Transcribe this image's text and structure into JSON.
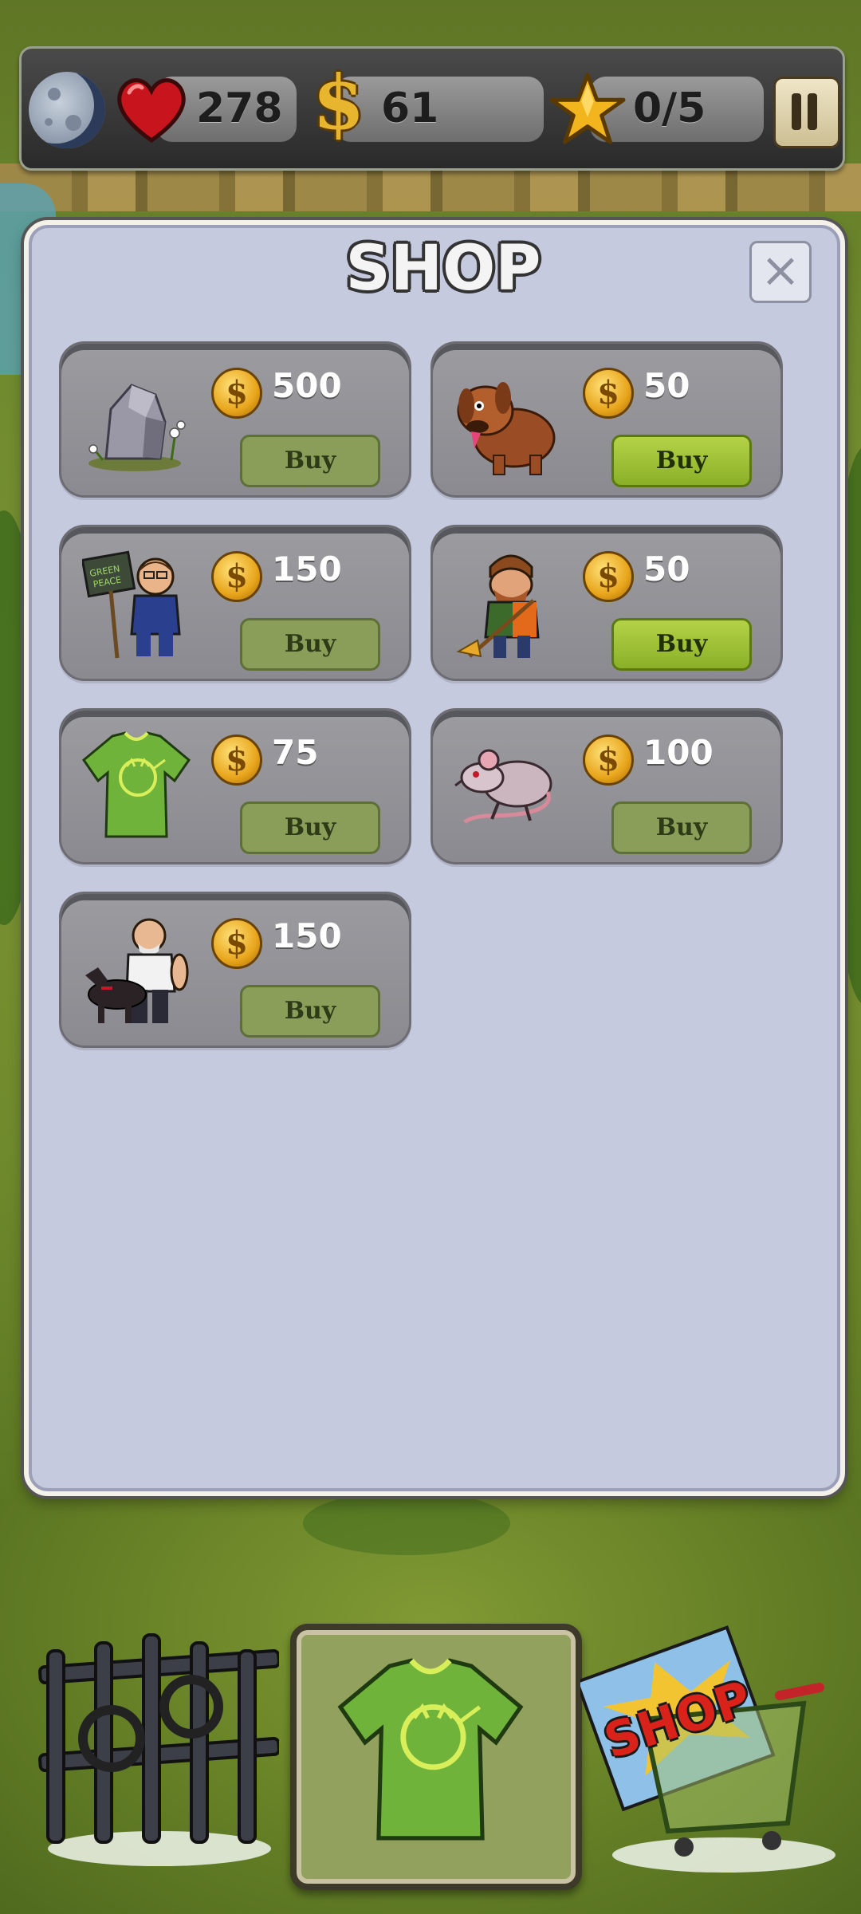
{
  "hud": {
    "moon_icon": "moon-icon",
    "health_value": "278",
    "money_value": "61",
    "money_symbol": "$",
    "stars_value": "0/5",
    "pause_icon": "pause-icon"
  },
  "shop": {
    "title": "SHOP",
    "close_icon": "close-icon",
    "currency_symbol": "$",
    "items": [
      {
        "name": "stone-with-flowers",
        "price": "500",
        "button": "Buy",
        "active": false
      },
      {
        "name": "angry-brown-dog",
        "price": "50",
        "button": "Buy",
        "active": true
      },
      {
        "name": "greenpeace-activist",
        "price": "150",
        "button": "Buy",
        "active": false
      },
      {
        "name": "hooded-janitor-with-broom",
        "price": "50",
        "button": "Buy",
        "active": true
      },
      {
        "name": "green-t-shirt",
        "price": "75",
        "button": "Buy",
        "active": false
      },
      {
        "name": "rat",
        "price": "100",
        "button": "Buy",
        "active": false
      },
      {
        "name": "bald-man-with-dog",
        "price": "150",
        "button": "Buy",
        "active": false
      }
    ]
  },
  "bottom_bar": {
    "gate_icon": "locked-gate-icon",
    "equipped_item_icon": "green-t-shirt-icon",
    "shop_cart_label": "SHOP"
  },
  "colors": {
    "panel": "#c6cadf",
    "card": "#8a8a90",
    "buy_inactive": "#8a9e5a",
    "buy_active": "#9cc235",
    "coin": "#e8a51c",
    "hud": "#333333"
  }
}
